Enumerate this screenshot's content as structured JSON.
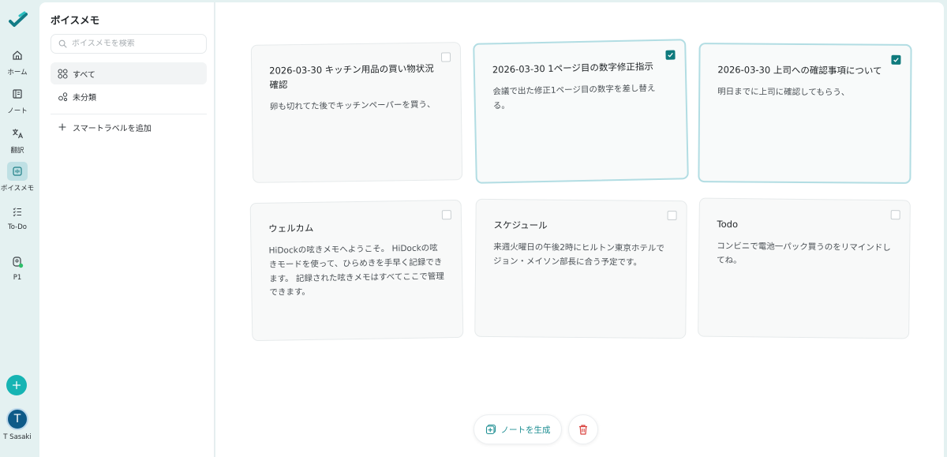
{
  "rail": {
    "items": [
      {
        "label": "ホーム",
        "icon": "home-icon"
      },
      {
        "label": "ノート",
        "icon": "note-icon"
      },
      {
        "label": "翻訳",
        "icon": "translate-icon"
      },
      {
        "label": "ボイスメモ",
        "icon": "voice-memo-icon",
        "active": true
      },
      {
        "label": "To-Do",
        "icon": "todo-icon"
      },
      {
        "label": "P1",
        "icon": "device-icon"
      }
    ],
    "avatar_initial": "T",
    "user_name": "T Sasaki"
  },
  "sidebar": {
    "title": "ボイスメモ",
    "search_placeholder": "ボイスメモを検索",
    "items": [
      {
        "label": "すべて",
        "active": true
      },
      {
        "label": "未分類"
      }
    ],
    "add_label": "スマートラベルを追加"
  },
  "cards": [
    {
      "title": "2026-03-30 キッチン用品の買い物状況確認",
      "body": "卵も切れてた後でキッチンペーパーを買う、",
      "checked": false
    },
    {
      "title": "2026-03-30 1ページ目の数字修正指示",
      "body": "会議で出た修正1ページ目の数字を差し替える。",
      "checked": true
    },
    {
      "title": "2026-03-30 上司への確認事項について",
      "body": "明日までに上司に確認してもらう、",
      "checked": true
    },
    {
      "title": "ウェルカム",
      "body": "HiDockの呟きメモへようこそ。 HiDockの呟きモードを使って、ひらめきを手早く記録できます。 記録された呟きメモはすべてここで管理できます。",
      "checked": false
    },
    {
      "title": "スケジュール",
      "body": "来週火曜日の午後2時にヒルトン東京ホテルでジョン・メイソン部長に合う予定です。",
      "checked": false
    },
    {
      "title": "Todo",
      "body": "コンビニで電池一パック買うのをリマインドしてね。",
      "checked": false
    }
  ],
  "actions": {
    "generate_note": "ノートを生成"
  },
  "colors": {
    "accent": "#16b4b3",
    "check": "#0f7a7d",
    "selected_border": "#b2dde3",
    "delete": "#d9423e"
  }
}
